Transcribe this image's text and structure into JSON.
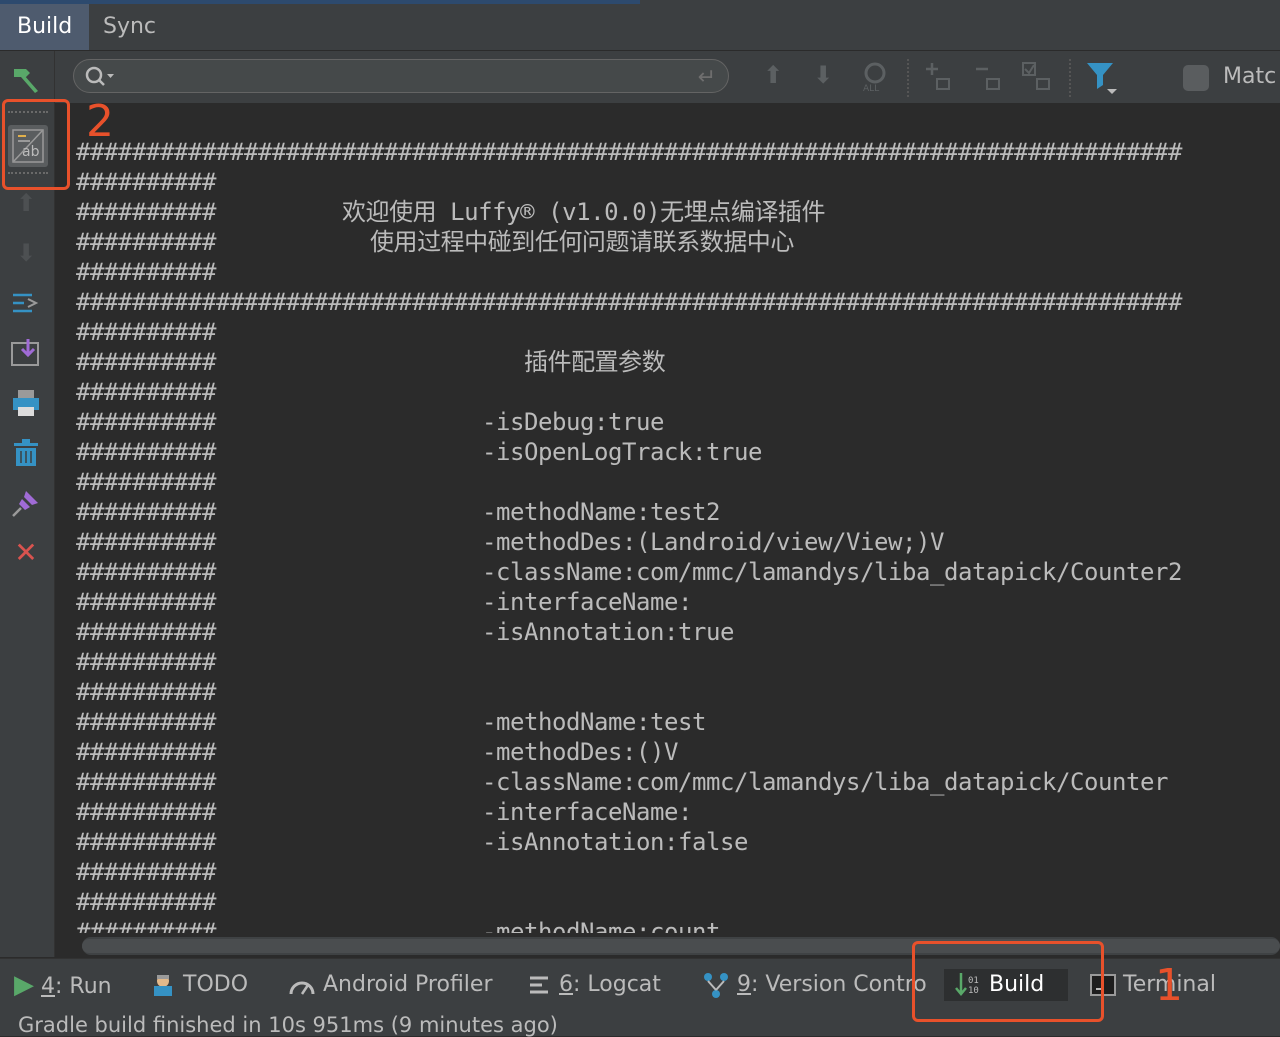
{
  "tabs": {
    "build": "Build",
    "sync": "Sync"
  },
  "toolbar": {
    "search_value": "",
    "match_label": "Matc"
  },
  "console_lines": [
    "###############################################################################",
    "##########",
    "##########         欢迎使用 Luffy® (v1.0.0)无埋点编译插件",
    "##########           使用过程中碰到任何问题请联系数据中心",
    "##########",
    "###############################################################################",
    "##########",
    "##########                      插件配置参数",
    "##########",
    "##########                   -isDebug:true",
    "##########                   -isOpenLogTrack:true",
    "##########",
    "##########                   -methodName:test2",
    "##########                   -methodDes:(Landroid/view/View;)V",
    "##########                   -className:com/mmc/lamandys/liba_datapick/Counter2",
    "##########                   -interfaceName:",
    "##########                   -isAnnotation:true",
    "##########",
    "##########",
    "##########                   -methodName:test",
    "##########                   -methodDes:()V",
    "##########                   -className:com/mmc/lamandys/liba_datapick/Counter",
    "##########                   -interfaceName:",
    "##########                   -isAnnotation:false",
    "##########",
    "##########",
    "##########                   -methodName:count"
  ],
  "annotations": {
    "one": "1",
    "two": "2"
  },
  "bottom_tabs": {
    "run_num": "4",
    "run_label": ": Run",
    "todo": "TODO",
    "profiler": "Android Profiler",
    "logcat_num": "6",
    "logcat_label": ": Logcat",
    "vc_num": "9",
    "vc_label": ": Version Contro",
    "build": "Build",
    "terminal": "Terminal"
  },
  "status": "Gradle build finished in 10s 951ms (9 minutes ago)",
  "colors": {
    "accent_annotation": "#e8512b",
    "bg": "#2b2b2b",
    "panel": "#3c3f41",
    "active_tab": "#4e5b6e"
  }
}
